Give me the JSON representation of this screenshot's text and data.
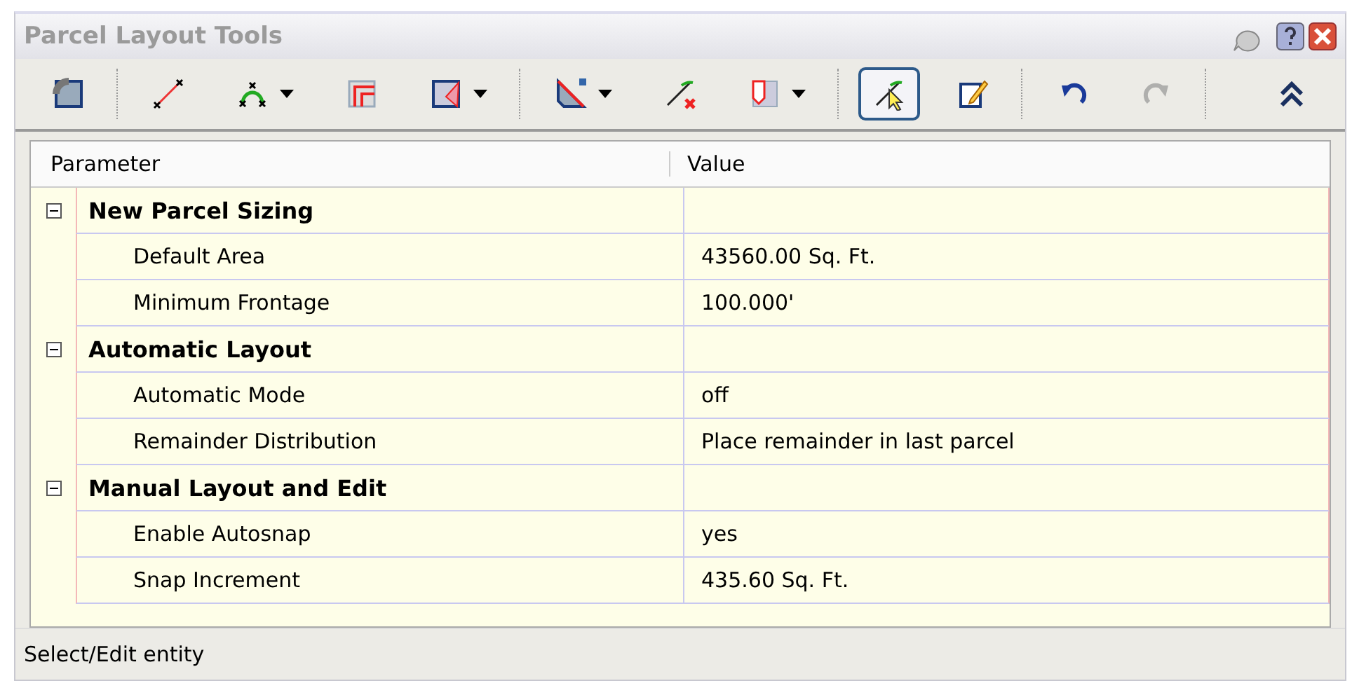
{
  "window": {
    "title": "Parcel Layout Tools"
  },
  "toolbar": [
    [
      {
        "dropdown": false,
        "pressed": false,
        "disabled": false
      }
    ],
    [
      {
        "dropdown": false,
        "pressed": false,
        "disabled": false
      },
      {
        "dropdown": true,
        "pressed": false,
        "disabled": false
      },
      {
        "dropdown": false,
        "pressed": false,
        "disabled": false
      },
      {
        "dropdown": true,
        "pressed": false,
        "disabled": false
      }
    ],
    [
      {
        "dropdown": true,
        "pressed": false,
        "disabled": false
      },
      {
        "dropdown": false,
        "pressed": false,
        "disabled": false
      },
      {
        "dropdown": true,
        "pressed": false,
        "disabled": false
      }
    ],
    [
      {
        "dropdown": false,
        "pressed": true,
        "disabled": false
      },
      {
        "dropdown": false,
        "pressed": false,
        "disabled": false
      }
    ],
    [
      {
        "dropdown": false,
        "pressed": false,
        "disabled": false
      },
      {
        "dropdown": false,
        "pressed": false,
        "disabled": true
      }
    ],
    [
      {
        "dropdown": false,
        "pressed": false,
        "disabled": false
      }
    ]
  ],
  "table": {
    "columns": [
      "Parameter",
      "Value"
    ],
    "categories": [
      {
        "name": "New Parcel Sizing",
        "expanded": true,
        "children": [
          {
            "name": "Default Area",
            "value": "43560.00 Sq. Ft."
          },
          {
            "name": "Minimum Frontage",
            "value": "100.000'"
          }
        ]
      },
      {
        "name": "Automatic Layout",
        "expanded": true,
        "children": [
          {
            "name": "Automatic Mode",
            "value": "off"
          },
          {
            "name": "Remainder Distribution",
            "value": "Place remainder in last parcel"
          }
        ]
      },
      {
        "name": "Manual Layout and Edit",
        "expanded": true,
        "children": [
          {
            "name": "Enable Autosnap",
            "value": "yes"
          },
          {
            "name": "Snap Increment",
            "value": "435.60 Sq. Ft."
          }
        ]
      }
    ]
  },
  "status_bar": "Select/Edit entity"
}
